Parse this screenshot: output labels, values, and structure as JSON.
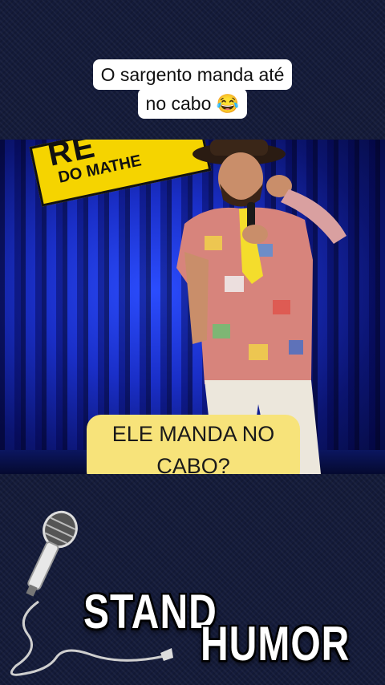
{
  "caption": {
    "line1": "O sargento manda até",
    "line2": "no cabo 😂"
  },
  "video": {
    "logo_line1": "RE",
    "logo_line2": "DO MATHE",
    "subtitle_line1": "ELE MANDA NO",
    "subtitle_line2": "CABO?"
  },
  "branding": {
    "word1": "STAND",
    "word2": "HUMOR",
    "icon": "microphone-icon"
  }
}
